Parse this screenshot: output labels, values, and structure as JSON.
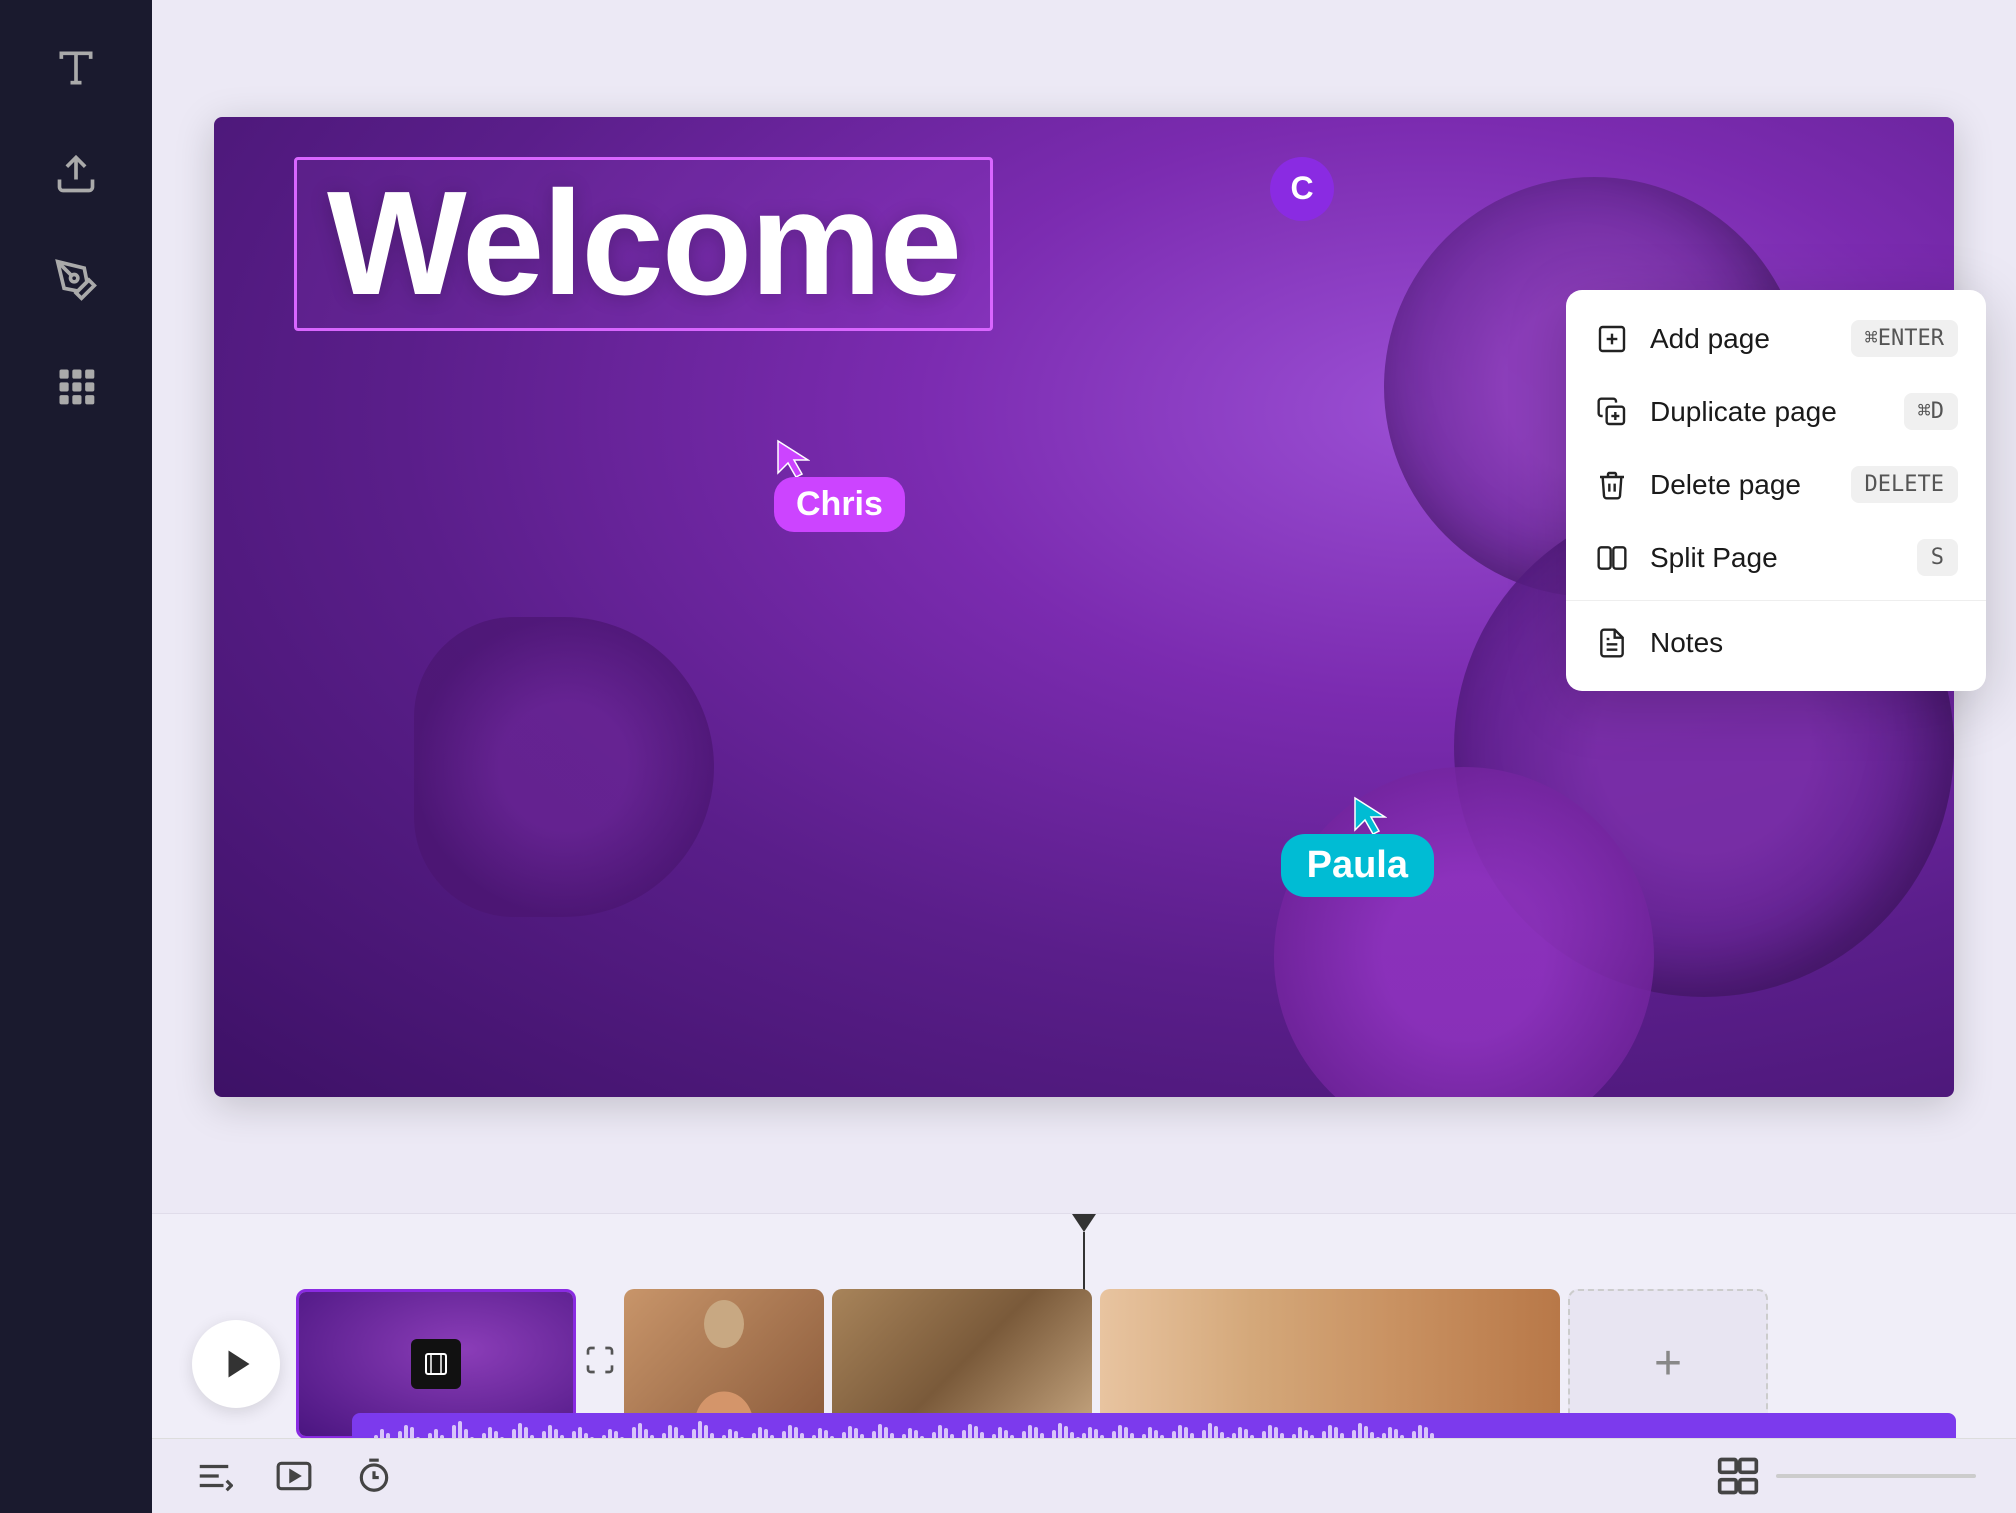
{
  "sidebar": {
    "icons": [
      {
        "name": "text-icon",
        "label": "T"
      },
      {
        "name": "upload-icon",
        "label": "upload"
      },
      {
        "name": "draw-icon",
        "label": "draw"
      },
      {
        "name": "apps-icon",
        "label": "apps"
      }
    ]
  },
  "canvas": {
    "welcome_text": "Welcome",
    "chris_label": "Chris",
    "paula_label": "Paula",
    "avatar_letter": "C"
  },
  "context_menu": {
    "items": [
      {
        "id": "add-page",
        "label": "Add page",
        "shortcut": "⌘ENTER",
        "has_shortcut": true
      },
      {
        "id": "duplicate-page",
        "label": "Duplicate page",
        "shortcut": "⌘D",
        "has_shortcut": true
      },
      {
        "id": "delete-page",
        "label": "Delete page",
        "shortcut": "DELETE",
        "has_shortcut": true
      },
      {
        "id": "split-page",
        "label": "Split Page",
        "shortcut": "S",
        "has_shortcut": true
      },
      {
        "id": "notes",
        "label": "Notes",
        "shortcut": "",
        "has_shortcut": false
      }
    ]
  },
  "timeline": {
    "play_label": "play",
    "add_clip_label": "+",
    "clips": [
      {
        "id": "clip-1",
        "type": "purple-video"
      },
      {
        "id": "clip-2",
        "type": "person-curly"
      },
      {
        "id": "clip-3",
        "type": "people-tablet"
      },
      {
        "id": "clip-4",
        "type": "woman-multi"
      }
    ]
  },
  "bottom_toolbar": {
    "icons": [
      {
        "name": "notes-icon",
        "label": "notes"
      },
      {
        "name": "preview-icon",
        "label": "preview"
      },
      {
        "name": "timer-icon",
        "label": "timer"
      }
    ],
    "storyboard_icon": "storyboard"
  },
  "colors": {
    "sidebar_bg": "#1a1a2e",
    "accent_purple": "#8a2be2",
    "chris_cursor": "#cc44ff",
    "paula_cursor": "#00bcd4",
    "menu_bg": "#ffffff",
    "canvas_bg": "#ece9f5"
  }
}
